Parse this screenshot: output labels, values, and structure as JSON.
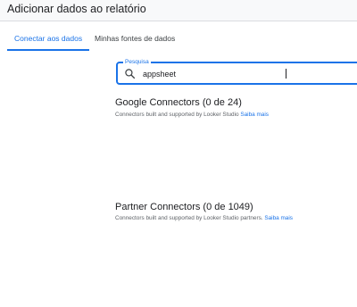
{
  "dialog": {
    "title": "Adicionar dados ao relatório"
  },
  "tabs": [
    {
      "label": "Conectar aos dados"
    },
    {
      "label": "Minhas fontes de dados"
    }
  ],
  "search": {
    "label": "Pesquisa",
    "value": "appsheet"
  },
  "sections": {
    "google": {
      "title": "Google Connectors (0 de 24)",
      "description": "Connectors built and supported by Looker Studio",
      "link": "Saiba mais"
    },
    "partner": {
      "title": "Partner Connectors (0 de 1049)",
      "description": "Connectors built and supported by Looker Studio partners.",
      "link": "Saiba mais"
    }
  },
  "colors": {
    "accent": "#1a73e8",
    "header_bg": "#f8f9fa"
  },
  "icons": {
    "search": "search-icon"
  }
}
